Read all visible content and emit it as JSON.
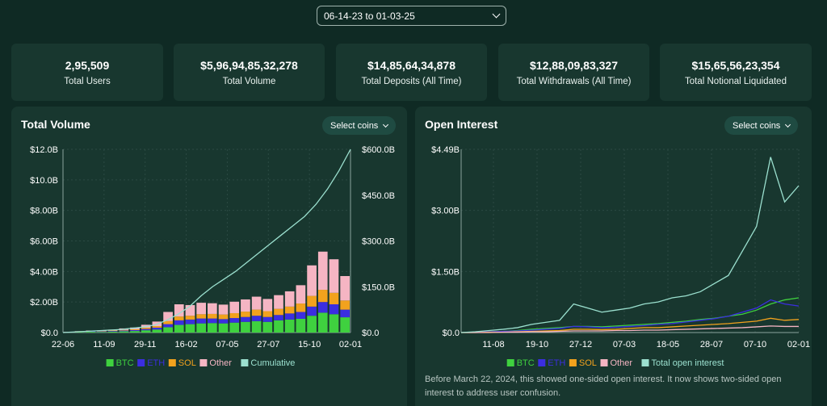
{
  "date_range": "06-14-23 to 01-03-25",
  "stats": [
    {
      "value": "2,95,509",
      "label": "Total Users"
    },
    {
      "value": "$5,96,94,85,32,278",
      "label": "Total Volume"
    },
    {
      "value": "$14,85,64,34,878",
      "label": "Total Deposits (All Time)"
    },
    {
      "value": "$12,88,09,83,327",
      "label": "Total Withdrawals (All Time)"
    },
    {
      "value": "$15,65,56,23,354",
      "label": "Total Notional Liquidated"
    }
  ],
  "volume_panel": {
    "title": "Total Volume",
    "select_label": "Select coins"
  },
  "oi_panel": {
    "title": "Open Interest",
    "select_label": "Select coins",
    "note": "Before March 22, 2024, this showed one-sided open interest. It now shows two-sided open interest to address user confusion."
  },
  "colors": {
    "btc": "#3fd13f",
    "eth": "#3b2ee0",
    "sol": "#f2a21d",
    "other": "#f5b5c3",
    "cumulative": "#9be0cf",
    "total_oi": "#9be0cf"
  },
  "chart_data": [
    {
      "type": "bar",
      "title": "Total Volume",
      "stacked": true,
      "x_ticks": [
        "22-06",
        "11-09",
        "29-11",
        "16-02",
        "07-05",
        "27-07",
        "15-10",
        "02-01"
      ],
      "y_ticks": [
        "$0.0",
        "$2.00B",
        "$4.00B",
        "$6.00B",
        "$8.00B",
        "$10.0B",
        "$12.0B"
      ],
      "y2_ticks": [
        "$0.0",
        "$150.0B",
        "$300.0B",
        "$450.0B",
        "$600.0B"
      ],
      "ylim": [
        0,
        12
      ],
      "y2lim": [
        0,
        600
      ],
      "units": "B",
      "grid": true,
      "legend_position": "bottom",
      "legend": [
        "BTC",
        "ETH",
        "SOL",
        "Other",
        "Cumulative"
      ],
      "series": [
        {
          "name": "BTC",
          "values": [
            0.02,
            0.03,
            0.05,
            0.04,
            0.06,
            0.08,
            0.1,
            0.15,
            0.2,
            0.35,
            0.5,
            0.55,
            0.6,
            0.62,
            0.6,
            0.65,
            0.7,
            0.75,
            0.7,
            0.8,
            0.85,
            0.9,
            1.1,
            1.3,
            1.2,
            1.0
          ]
        },
        {
          "name": "ETH",
          "values": [
            0.01,
            0.02,
            0.03,
            0.03,
            0.04,
            0.05,
            0.06,
            0.08,
            0.12,
            0.2,
            0.3,
            0.3,
            0.32,
            0.3,
            0.28,
            0.3,
            0.32,
            0.35,
            0.32,
            0.35,
            0.4,
            0.45,
            0.6,
            0.7,
            0.65,
            0.5
          ]
        },
        {
          "name": "SOL",
          "values": [
            0.0,
            0.01,
            0.01,
            0.02,
            0.03,
            0.04,
            0.05,
            0.08,
            0.1,
            0.2,
            0.25,
            0.25,
            0.28,
            0.3,
            0.3,
            0.32,
            0.35,
            0.4,
            0.38,
            0.4,
            0.45,
            0.55,
            0.7,
            0.8,
            0.75,
            0.6
          ]
        },
        {
          "name": "Other",
          "values": [
            0.02,
            0.03,
            0.04,
            0.05,
            0.06,
            0.1,
            0.12,
            0.2,
            0.3,
            0.6,
            0.8,
            0.7,
            0.75,
            0.7,
            0.65,
            0.75,
            0.8,
            0.85,
            0.8,
            0.9,
            1.0,
            1.2,
            2.0,
            2.5,
            2.2,
            1.6
          ]
        },
        {
          "name": "Cumulative",
          "values": [
            0,
            2,
            4,
            6,
            8,
            10,
            14,
            18,
            25,
            40,
            60,
            85,
            120,
            150,
            175,
            200,
            230,
            260,
            290,
            320,
            350,
            380,
            420,
            470,
            530,
            600
          ]
        }
      ]
    },
    {
      "type": "line",
      "title": "Open Interest",
      "x_ticks": [
        "11-08",
        "19-10",
        "27-12",
        "07-03",
        "18-05",
        "28-07",
        "07-10",
        "02-01"
      ],
      "y_ticks": [
        "$0.0",
        "$1.50B",
        "$3.00B",
        "$4.49B"
      ],
      "ylim": [
        0,
        4.49
      ],
      "units": "B",
      "grid": true,
      "legend_position": "bottom",
      "legend": [
        "BTC",
        "ETH",
        "SOL",
        "Other",
        "Total open interest"
      ],
      "series": [
        {
          "name": "BTC",
          "values": [
            0.0,
            0.01,
            0.02,
            0.03,
            0.05,
            0.08,
            0.1,
            0.12,
            0.15,
            0.15,
            0.14,
            0.16,
            0.18,
            0.2,
            0.22,
            0.25,
            0.28,
            0.32,
            0.35,
            0.4,
            0.45,
            0.55,
            0.7,
            0.8,
            0.85
          ]
        },
        {
          "name": "ETH",
          "values": [
            0.0,
            0.01,
            0.02,
            0.03,
            0.04,
            0.06,
            0.08,
            0.1,
            0.15,
            0.14,
            0.12,
            0.13,
            0.15,
            0.17,
            0.2,
            0.22,
            0.26,
            0.3,
            0.34,
            0.4,
            0.5,
            0.6,
            0.8,
            0.7,
            0.65
          ]
        },
        {
          "name": "SOL",
          "values": [
            0.0,
            0.0,
            0.01,
            0.01,
            0.02,
            0.03,
            0.04,
            0.05,
            0.08,
            0.08,
            0.07,
            0.08,
            0.1,
            0.12,
            0.12,
            0.14,
            0.16,
            0.18,
            0.2,
            0.22,
            0.25,
            0.28,
            0.35,
            0.3,
            0.32
          ]
        },
        {
          "name": "Other",
          "values": [
            0.0,
            0.0,
            0.0,
            0.01,
            0.01,
            0.02,
            0.02,
            0.03,
            0.04,
            0.04,
            0.04,
            0.05,
            0.05,
            0.06,
            0.06,
            0.07,
            0.08,
            0.09,
            0.1,
            0.11,
            0.12,
            0.14,
            0.16,
            0.15,
            0.15
          ]
        },
        {
          "name": "Total open interest",
          "values": [
            0.0,
            0.02,
            0.05,
            0.08,
            0.12,
            0.2,
            0.25,
            0.3,
            0.7,
            0.6,
            0.5,
            0.55,
            0.6,
            0.7,
            0.75,
            0.85,
            0.9,
            1.0,
            1.2,
            1.4,
            2.0,
            2.6,
            4.3,
            3.2,
            3.6
          ]
        }
      ]
    }
  ]
}
